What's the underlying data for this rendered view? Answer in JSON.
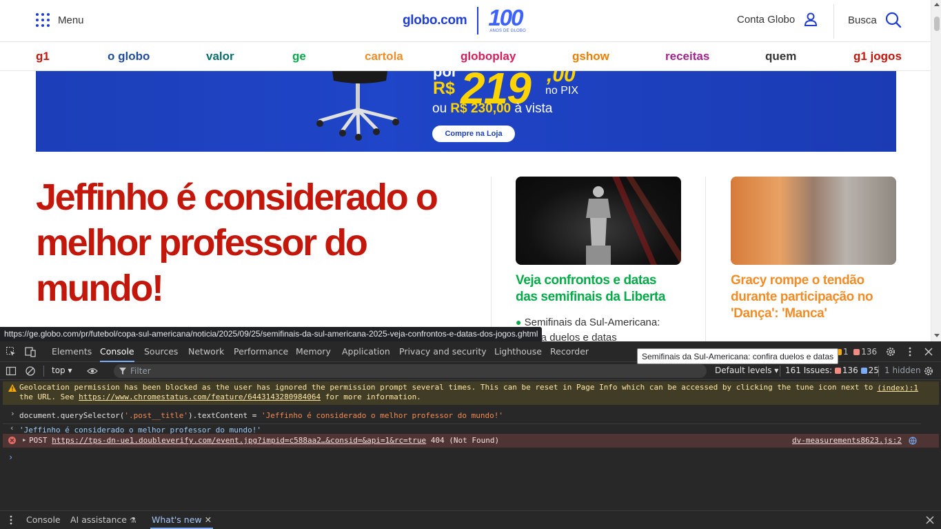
{
  "header": {
    "menu_label": "Menu",
    "logo_text": "globo.com",
    "logo_100": "100",
    "logo_100_sub": "ANOS DE GLOBO",
    "account_label": "Conta Globo",
    "search_label": "Busca",
    "brand_color": "#1f3ed6"
  },
  "nav": {
    "items": [
      {
        "label": "g1",
        "color": "#c4170c"
      },
      {
        "label": "o globo",
        "color": "#1f4b99"
      },
      {
        "label": "valor",
        "color": "#0a6e6e"
      },
      {
        "label": "ge",
        "color": "#06aa48"
      },
      {
        "label": "cartola",
        "color": "#f08d29"
      },
      {
        "label": "globoplay",
        "color": "#d61f5a"
      },
      {
        "label": "gshow",
        "color": "#f07d00"
      },
      {
        "label": "receitas",
        "color": "#a3248f"
      },
      {
        "label": "quem",
        "color": "#333333"
      },
      {
        "label": "g1 jogos",
        "color": "#c4170c"
      }
    ]
  },
  "ad": {
    "por": "por",
    "currency": "R$",
    "price": "219",
    "cents": ",00",
    "pix": "no PIX",
    "vista_prefix": "ou",
    "vista_price": "R$ 230,00",
    "vista_suffix": "à vista",
    "cta": "Compre na Loja"
  },
  "main": {
    "headline": "Jeffinho é considerado o melhor professor do mundo!",
    "card1": {
      "title": "Veja confrontos e datas das semifinais da Liberta",
      "related": "Semifinais da Sul-Americana: confira duelos e datas"
    },
    "card2": {
      "title": "Gracy rompe o tendão durante participação no 'Dança': 'Manca'"
    }
  },
  "status_url": "https://ge.globo.com/pr/futebol/copa-sul-americana/noticia/2025/09/25/semifinais-da-sul-americana-2025-veja-confrontos-e-datas-dos-jogos.ghtml",
  "tooltip": "Semifinais da Sul-Americana: confira duelos e datas",
  "devtools": {
    "tabs": [
      "Elements",
      "Console",
      "Sources",
      "Network",
      "Performance",
      "Memory",
      "Application",
      "Privacy and security",
      "Lighthouse",
      "Recorder"
    ],
    "active_tab": "Console",
    "warn_count": "1",
    "issue_count": "136",
    "context": "top",
    "filter_placeholder": "Filter",
    "levels": "Default levels",
    "issues_label": "161 Issues:",
    "issues_warn": "136",
    "issues_info": "25",
    "hidden": "1 hidden",
    "messages": {
      "warning_line1": "Geolocation permission has been blocked as the user has ignored the permission prompt several times. This can be reset in Page Info which can be accessed by clicking the tune icon next to",
      "warning_line2_prefix": "the URL. See",
      "warning_link": "https://www.chromestatus.com/feature/6443143280984064",
      "warning_line2_suffix": "for more information.",
      "warning_source": "(index):1",
      "input_prefix": "document.",
      "input_method": "querySelector",
      "input_arg": "'.post__title'",
      "input_rest": ").textContent = ",
      "input_value": "'Jeffinho é considerado o melhor professor do mundo!'",
      "output_value": "'Jeffinho é considerado o melhor professor do mundo!'",
      "error_method": "POST",
      "error_url": "https://tps-dn-ue1.doubleverify.com/event.jpg?impid=c588aa2…&consid=&api=1&rc=true",
      "error_status": "404 (Not Found)",
      "error_source": "dv-measurements8623.js:2"
    },
    "drawer": {
      "tabs": [
        "Console",
        "AI assistance",
        "What's new"
      ],
      "active": "What's new"
    }
  }
}
